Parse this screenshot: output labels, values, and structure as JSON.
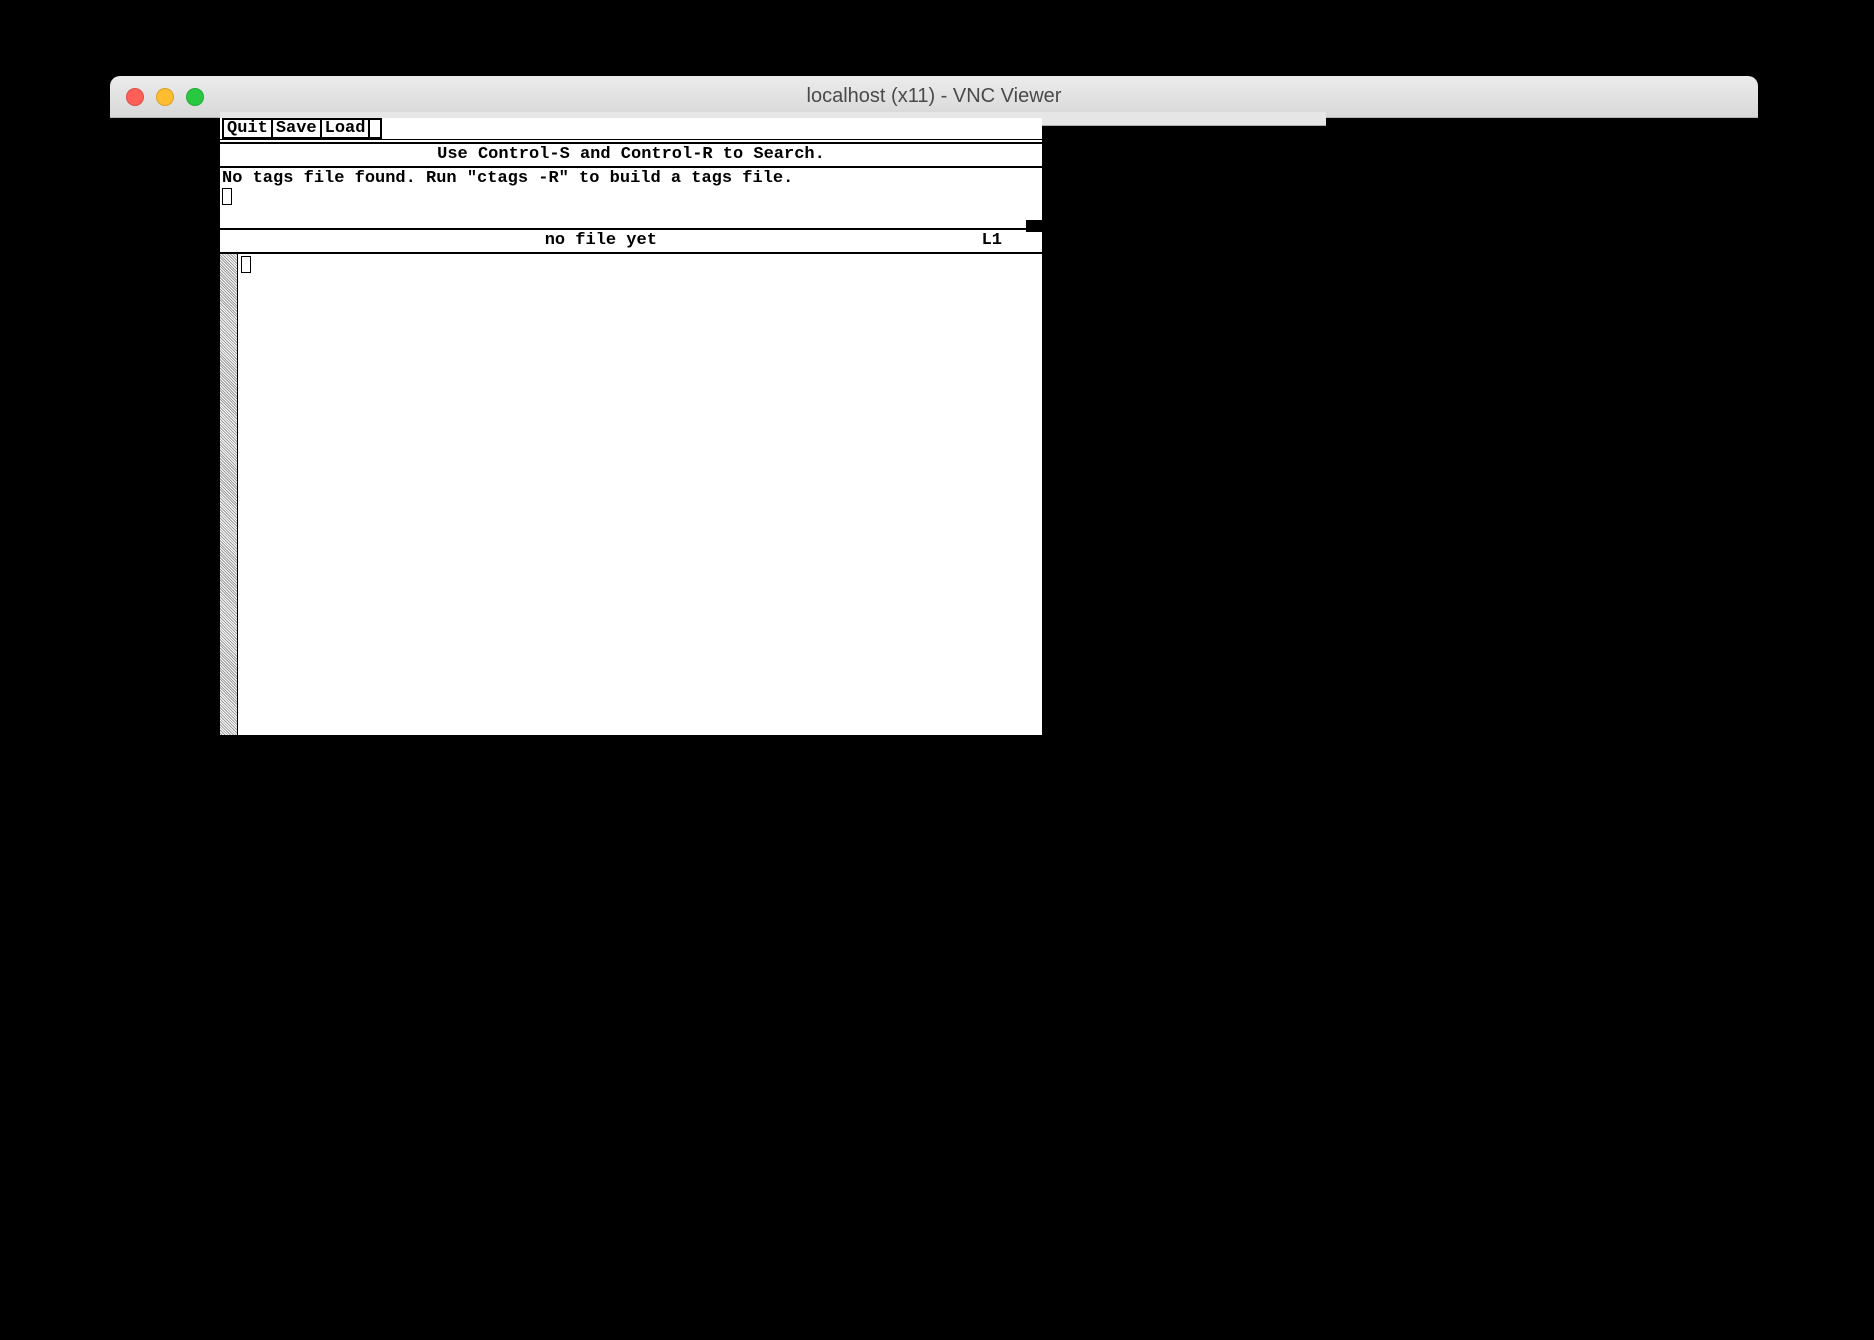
{
  "window": {
    "title": "localhost (x11) - VNC Viewer"
  },
  "menu": {
    "quit": "Quit",
    "save": "Save",
    "load": "Load"
  },
  "help_line": "Use Control-S and Control-R to Search.",
  "message": "No tags file found. Run \"ctags -R\" to build a tags file.",
  "status": {
    "filename": "no file yet",
    "line_indicator": "L1"
  }
}
